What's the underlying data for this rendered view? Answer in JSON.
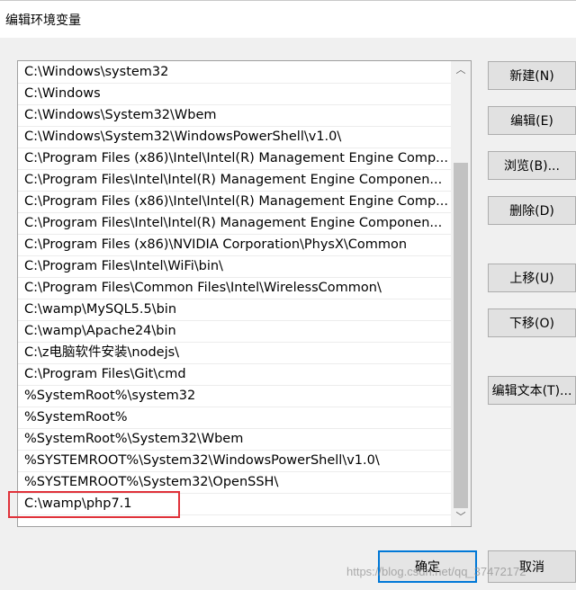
{
  "window": {
    "title": "编辑环境变量"
  },
  "paths": [
    "C:\\Windows\\system32",
    "C:\\Windows",
    "C:\\Windows\\System32\\Wbem",
    "C:\\Windows\\System32\\WindowsPowerShell\\v1.0\\",
    "C:\\Program Files (x86)\\Intel\\Intel(R) Management Engine Comp...",
    "C:\\Program Files\\Intel\\Intel(R) Management Engine Componen...",
    "C:\\Program Files (x86)\\Intel\\Intel(R) Management Engine Comp...",
    "C:\\Program Files\\Intel\\Intel(R) Management Engine Componen...",
    "C:\\Program Files (x86)\\NVIDIA Corporation\\PhysX\\Common",
    "C:\\Program Files\\Intel\\WiFi\\bin\\",
    "C:\\Program Files\\Common Files\\Intel\\WirelessCommon\\",
    "C:\\wamp\\MySQL5.5\\bin",
    "C:\\wamp\\Apache24\\bin",
    "C:\\z电脑软件安装\\nodejs\\",
    "C:\\Program Files\\Git\\cmd",
    "%SystemRoot%\\system32",
    "%SystemRoot%",
    "%SystemRoot%\\System32\\Wbem",
    "%SYSTEMROOT%\\System32\\WindowsPowerShell\\v1.0\\",
    "%SYSTEMROOT%\\System32\\OpenSSH\\",
    "C:\\wamp\\php7.1"
  ],
  "buttons": {
    "new": "新建(N)",
    "edit": "编辑(E)",
    "browse": "浏览(B)...",
    "delete": "删除(D)",
    "move_up": "上移(U)",
    "move_down": "下移(O)",
    "edit_text": "编辑文本(T)...",
    "ok": "确定",
    "cancel": "取消"
  },
  "scrollbar": {
    "up_glyph": "︿",
    "down_glyph": "﹀"
  },
  "watermark": "https://blog.csdn.net/qq_37472172",
  "colors": {
    "highlight": "#e0323a",
    "default_button_border": "#0078d7"
  }
}
